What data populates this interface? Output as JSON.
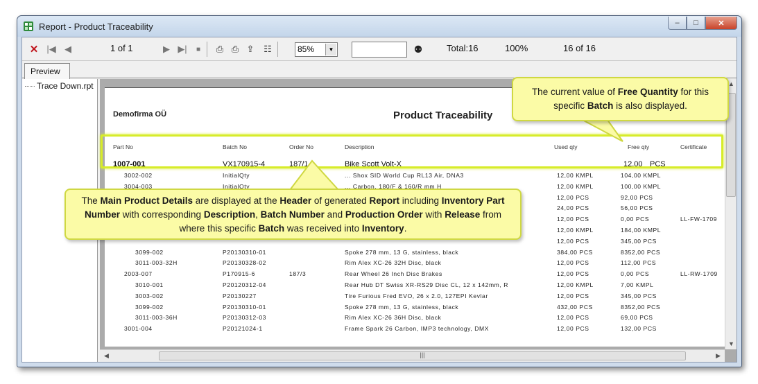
{
  "window": {
    "title": "Report - Product Traceability"
  },
  "toolbar": {
    "page_indicator": "1 of 1",
    "zoom": "85%",
    "search_value": "",
    "total": "Total:16",
    "percent": "100%",
    "records": "16 of 16"
  },
  "tabs": {
    "preview": "Preview"
  },
  "tree": {
    "item": "Trace Down.rpt"
  },
  "report": {
    "company": "Demofirma OÜ",
    "title": "Product Traceability",
    "headers": {
      "part_no": "Part No",
      "batch_no": "Batch No",
      "order_no": "Order No",
      "description": "Description",
      "used_qty": "Used qty",
      "free_qty": "Free qty",
      "certificate": "Certificate"
    },
    "main": {
      "part_no": "1007-001",
      "batch_no": "VX170915-4",
      "order_no": "187/1",
      "description": "Bike Scott Volt-X",
      "free_qty": "12,00",
      "unit": "PCS"
    },
    "rows": [
      {
        "part": "3002-002",
        "batch": "InitialQty",
        "order": "",
        "desc": "... Shox SID World Cup RL13 Air, DNA3",
        "used": "12,00 KMPL",
        "free": "104,00 KMPL",
        "cert": ""
      },
      {
        "part": "3004-003",
        "batch": "InitialQty",
        "order": "",
        "desc": "... Carbon, 180/F & 160/R mm H",
        "used": "12,00 KMPL",
        "free": "100,00 KMPL",
        "cert": ""
      },
      {
        "part": "",
        "batch": "",
        "order": "",
        "desc": "",
        "used": "12,00 PCS",
        "free": "92,00 PCS",
        "cert": ""
      },
      {
        "part": "",
        "batch": "",
        "order": "",
        "desc": "",
        "used": "24,00 PCS",
        "free": "56,00 PCS",
        "cert": ""
      },
      {
        "part": "",
        "batch": "",
        "order": "",
        "desc": "",
        "used": "12,00 PCS",
        "free": "0,00 PCS",
        "cert": "LL-FW-1709"
      },
      {
        "part": "",
        "batch": "",
        "order": "",
        "desc": "",
        "used": "12,00 KMPL",
        "free": "184,00 KMPL",
        "cert": ""
      },
      {
        "part": "",
        "batch": "",
        "order": "",
        "desc": "",
        "used": "12,00 PCS",
        "free": "345,00 PCS",
        "cert": ""
      },
      {
        "part": "3099-002",
        "batch": "P20130310-01",
        "order": "",
        "desc": "Spoke 278 mm, 13 G, stainless, black",
        "used": "384,00 PCS",
        "free": "8352,00 PCS",
        "cert": ""
      },
      {
        "part": "3011-003-32H",
        "batch": "P20130328-02",
        "order": "",
        "desc": "Rim Alex XC-26 32H Disc, black",
        "used": "12,00 PCS",
        "free": "112,00 PCS",
        "cert": ""
      },
      {
        "part": "2003-007",
        "batch": "P170915-6",
        "order": "187/3",
        "desc": "Rear Wheel 26 Inch Disc Brakes",
        "used": "12,00 PCS",
        "free": "0,00 PCS",
        "cert": "LL-RW-1709"
      },
      {
        "part": "3010-001",
        "batch": "P20120312-04",
        "order": "",
        "desc": "Rear Hub DT Swiss XR-RS29 Disc CL, 12 x 142mm, R",
        "used": "12,00 KMPL",
        "free": "7,00 KMPL",
        "cert": ""
      },
      {
        "part": "3003-002",
        "batch": "P20130227",
        "order": "",
        "desc": "Tire Furious Fred EVO, 26 x 2.0, 127EPI Kevlar",
        "used": "12,00 PCS",
        "free": "345,00 PCS",
        "cert": ""
      },
      {
        "part": "3099-002",
        "batch": "P20130310-01",
        "order": "",
        "desc": "Spoke 278 mm, 13 G, stainless, black",
        "used": "432,00 PCS",
        "free": "8352,00 PCS",
        "cert": ""
      },
      {
        "part": "3011-003-36H",
        "batch": "P20130312-03",
        "order": "",
        "desc": "Rim Alex XC-26 36H Disc, black",
        "used": "12,00 PCS",
        "free": "69,00 PCS",
        "cert": ""
      },
      {
        "part": "3001-004",
        "batch": "P20121024-1",
        "order": "",
        "desc": "Frame Spark 26 Carbon, IMP3 technology, DMX",
        "used": "12,00 PCS",
        "free": "132,00 PCS",
        "cert": ""
      }
    ]
  },
  "callouts": {
    "free_qty": {
      "p1": "The current value of ",
      "b1": "Free Quantity",
      "p2": " for this specific ",
      "b2": "Batch",
      "p3": " is also displayed."
    },
    "header": {
      "p1": "The ",
      "b1": "Main Product Details",
      "p2": " are displayed at the ",
      "b2": "Header",
      "p3": " of generated ",
      "b3": "Report",
      "p4": " including ",
      "b4": "Inventory Part Number",
      "p5": " with corresponding ",
      "b5": "Description",
      "p6": ", ",
      "b6": "Batch Number",
      "p7": " and ",
      "b7": "Production Order",
      "p8": " with ",
      "b8": "Release",
      "p9": " from where this specific ",
      "b9": "Batch",
      "p10": " was received into ",
      "b10": "Inventory",
      "p11": "."
    }
  }
}
